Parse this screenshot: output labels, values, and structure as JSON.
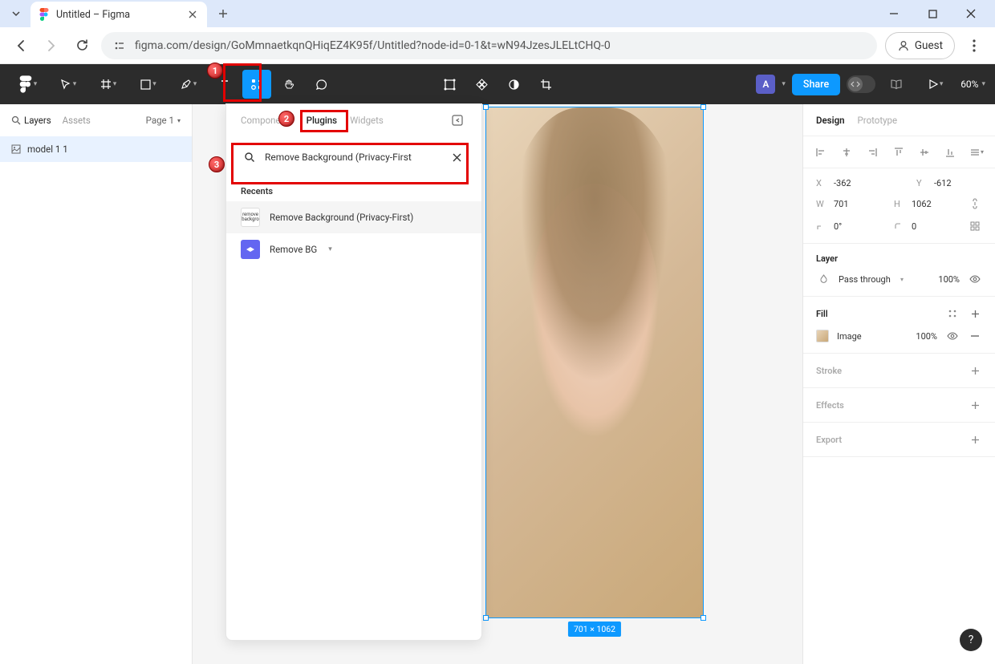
{
  "browser": {
    "tab_title": "Untitled – Figma",
    "url": "figma.com/design/GoMmnaetkqnQHiqEZ4K95f/Untitled?node-id=0-1&t=wN94JzesJLELtCHQ-0",
    "guest_label": "Guest"
  },
  "toolbar": {
    "avatar_letter": "A",
    "share_label": "Share",
    "zoom": "60%"
  },
  "left_panel": {
    "tab_layers": "Layers",
    "tab_assets": "Assets",
    "page_label": "Page 1",
    "layer_name": "model 1 1"
  },
  "resources": {
    "tab_components": "Components",
    "tab_plugins": "Plugins",
    "tab_widgets": "Widgets",
    "search_value": "Remove Background (Privacy-First",
    "recents_label": "Recents",
    "items": [
      {
        "label": "Remove Background (Privacy-First)"
      },
      {
        "label": "Remove BG"
      }
    ]
  },
  "canvas": {
    "dim_label": "701 × 1062"
  },
  "design": {
    "tab_design": "Design",
    "tab_prototype": "Prototype",
    "x_label": "X",
    "x_val": "-362",
    "y_label": "Y",
    "y_val": "-612",
    "w_label": "W",
    "w_val": "701",
    "h_label": "H",
    "h_val": "1062",
    "r_val": "0°",
    "c_val": "0",
    "layer_title": "Layer",
    "blend_mode": "Pass through",
    "opacity": "100%",
    "fill_title": "Fill",
    "fill_type": "Image",
    "fill_opacity": "100%",
    "stroke_title": "Stroke",
    "effects_title": "Effects",
    "export_title": "Export"
  },
  "callouts": {
    "c1": "1",
    "c2": "2",
    "c3": "3"
  }
}
